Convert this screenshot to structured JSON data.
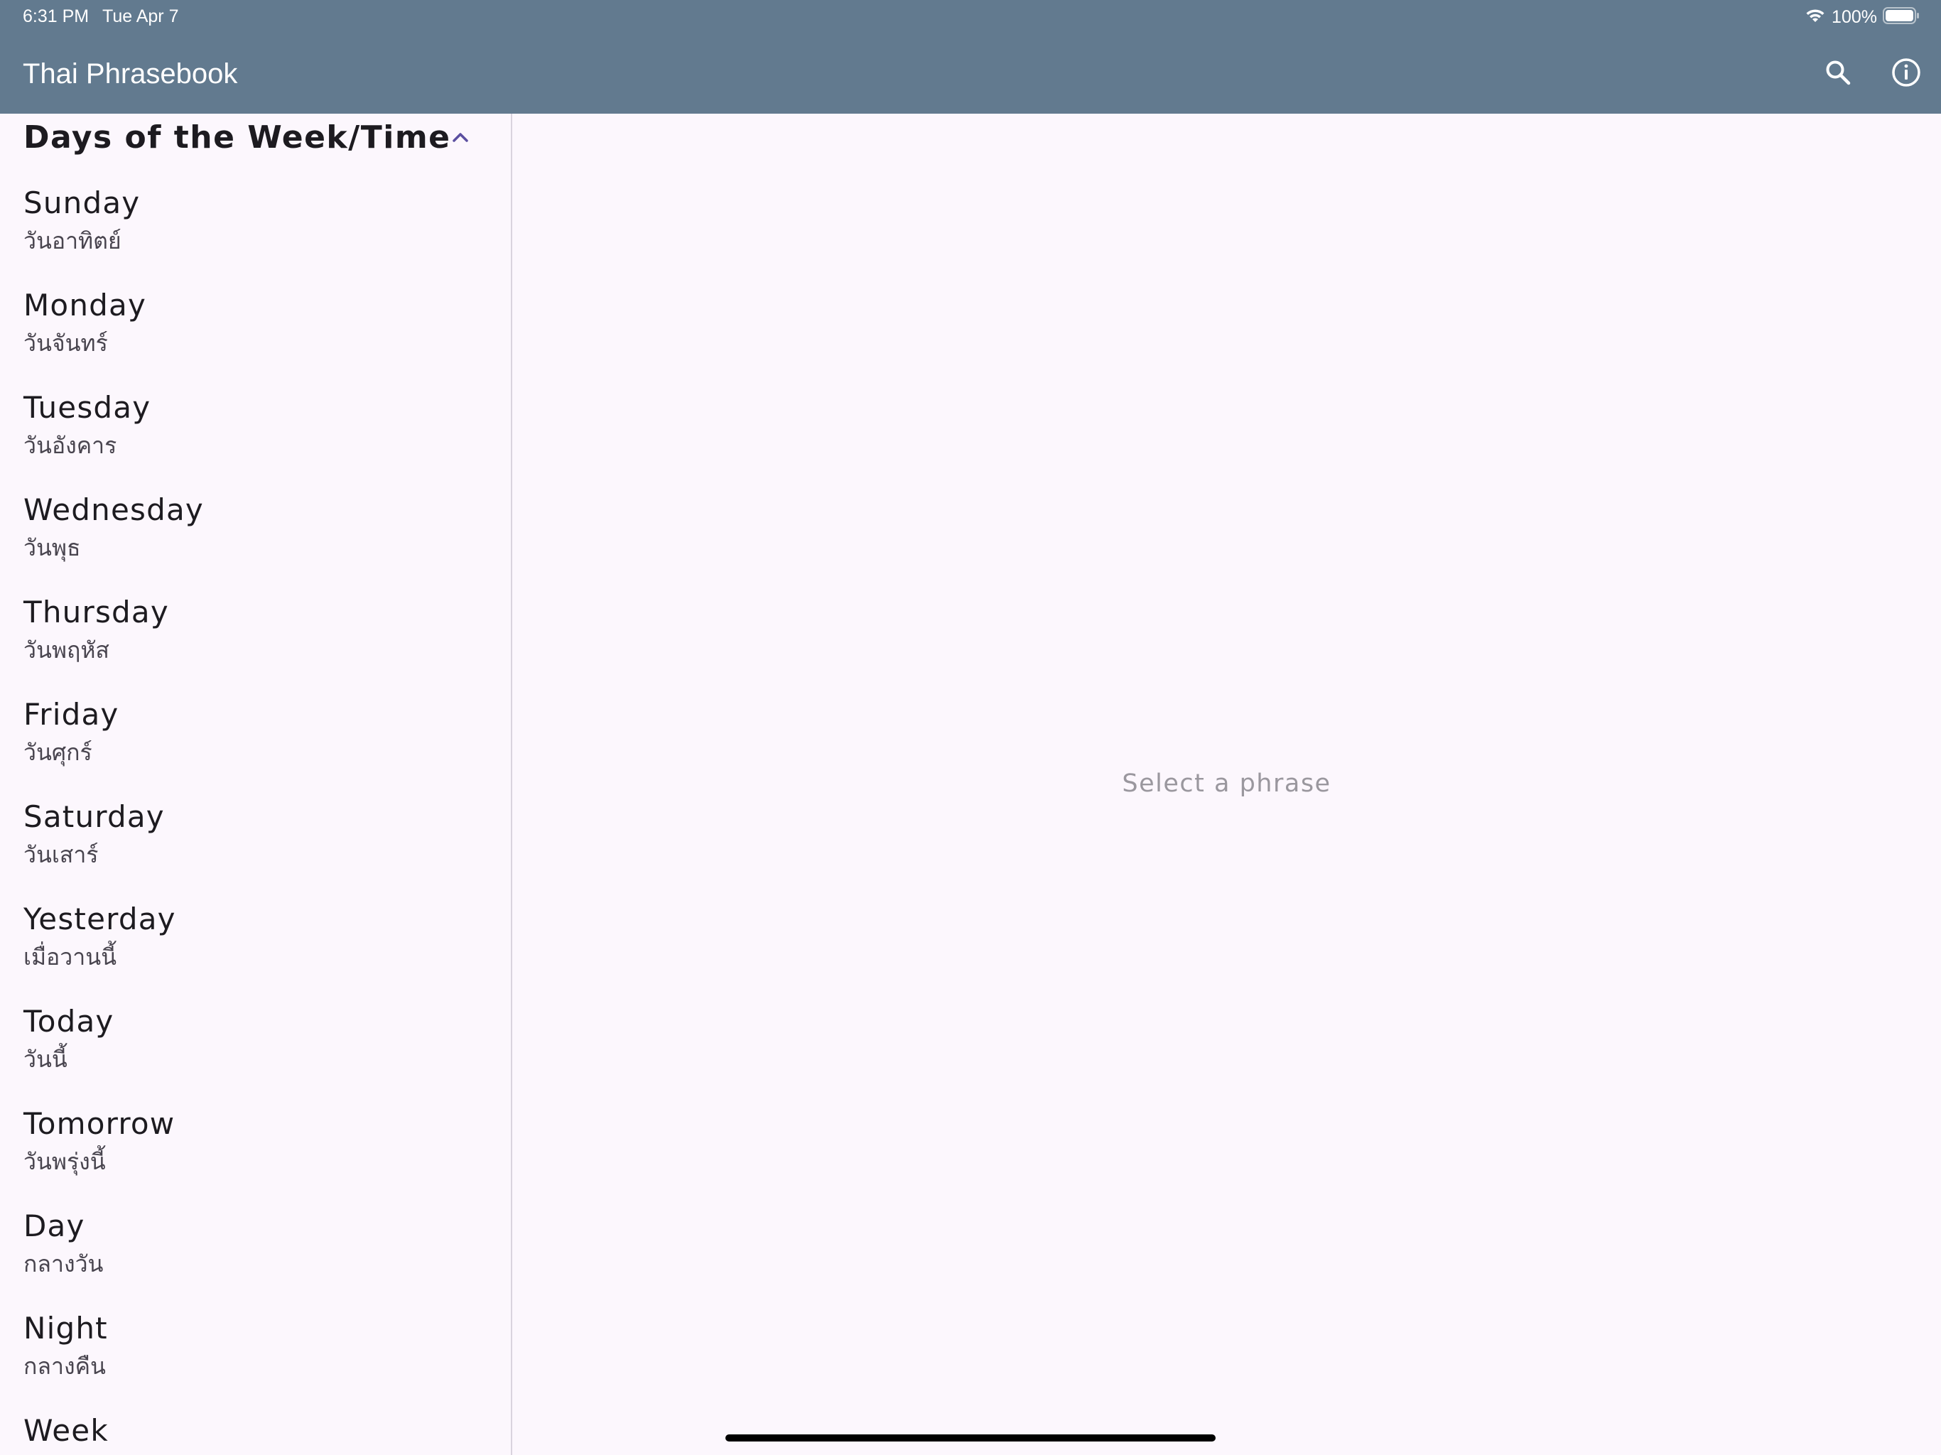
{
  "status_bar": {
    "time": "6:31 PM",
    "date": "Tue Apr 7",
    "battery_percent": "100%",
    "battery_level": 1.0,
    "icons": [
      "wifi-icon",
      "battery-icon"
    ]
  },
  "app_bar": {
    "title": "Thai Phrasebook",
    "actions": [
      "search-icon",
      "info-icon"
    ]
  },
  "sidebar": {
    "section_title": "Days of the Week/Time",
    "expanded": true,
    "phrases": [
      {
        "en": "Sunday",
        "th": "วันอาทิตย์"
      },
      {
        "en": "Monday",
        "th": "วันจันทร์"
      },
      {
        "en": "Tuesday",
        "th": "วันอังคาร"
      },
      {
        "en": "Wednesday",
        "th": "วันพุธ"
      },
      {
        "en": "Thursday",
        "th": "วันพฤหัส"
      },
      {
        "en": "Friday",
        "th": "วันศุกร์"
      },
      {
        "en": "Saturday",
        "th": "วันเสาร์"
      },
      {
        "en": "Yesterday",
        "th": "เมื่อวานนี้"
      },
      {
        "en": "Today",
        "th": "วันนี้"
      },
      {
        "en": "Tomorrow",
        "th": "วันพรุ่งนี้"
      },
      {
        "en": "Day",
        "th": "กลางวัน"
      },
      {
        "en": "Night",
        "th": "กลางคืน"
      },
      {
        "en": "Week",
        "th": ""
      }
    ]
  },
  "detail": {
    "placeholder": "Select a phrase"
  },
  "colors": {
    "app_bar": "#627A8F",
    "background": "#FCF7FD",
    "accent": "#5B4FA0",
    "divider": "#D9D3DE",
    "placeholder_text": "#9A979E"
  }
}
